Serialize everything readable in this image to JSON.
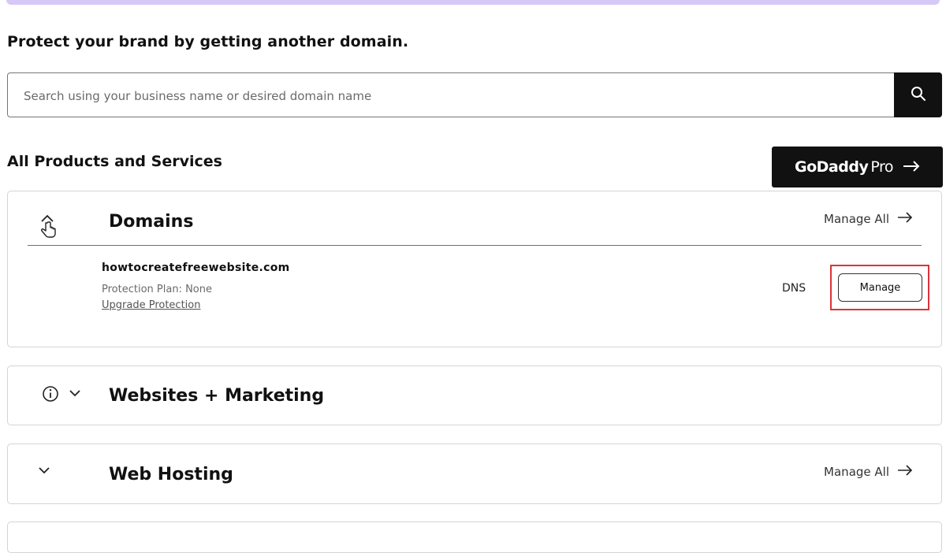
{
  "promo": {
    "heading": "Protect your brand by getting another domain."
  },
  "search": {
    "placeholder": "Search using your business name or desired domain name",
    "value": ""
  },
  "products": {
    "title": "All Products and Services",
    "pro_button": {
      "brand": "GoDaddy",
      "suffix": "Pro"
    }
  },
  "cards": {
    "domains": {
      "title": "Domains",
      "manage_all": "Manage All",
      "item": {
        "domain": "howtocreatefreewebsite.com",
        "protection": "Protection Plan: None",
        "upgrade": "Upgrade Protection",
        "dns": "DNS",
        "manage": "Manage"
      }
    },
    "websites": {
      "title": "Websites + Marketing"
    },
    "hosting": {
      "title": "Web Hosting",
      "manage_all": "Manage All"
    }
  },
  "icons": {
    "search": "search-icon",
    "arrow": "arrow-right-icon",
    "collapse": "chevron-up-icon",
    "cursor": "hand-cursor-icon",
    "info": "info-icon",
    "expand": "chevron-down-icon"
  },
  "colors": {
    "accent_strip": "#d6c8f7",
    "highlight": "#d9343a",
    "dark_button": "#111111"
  }
}
